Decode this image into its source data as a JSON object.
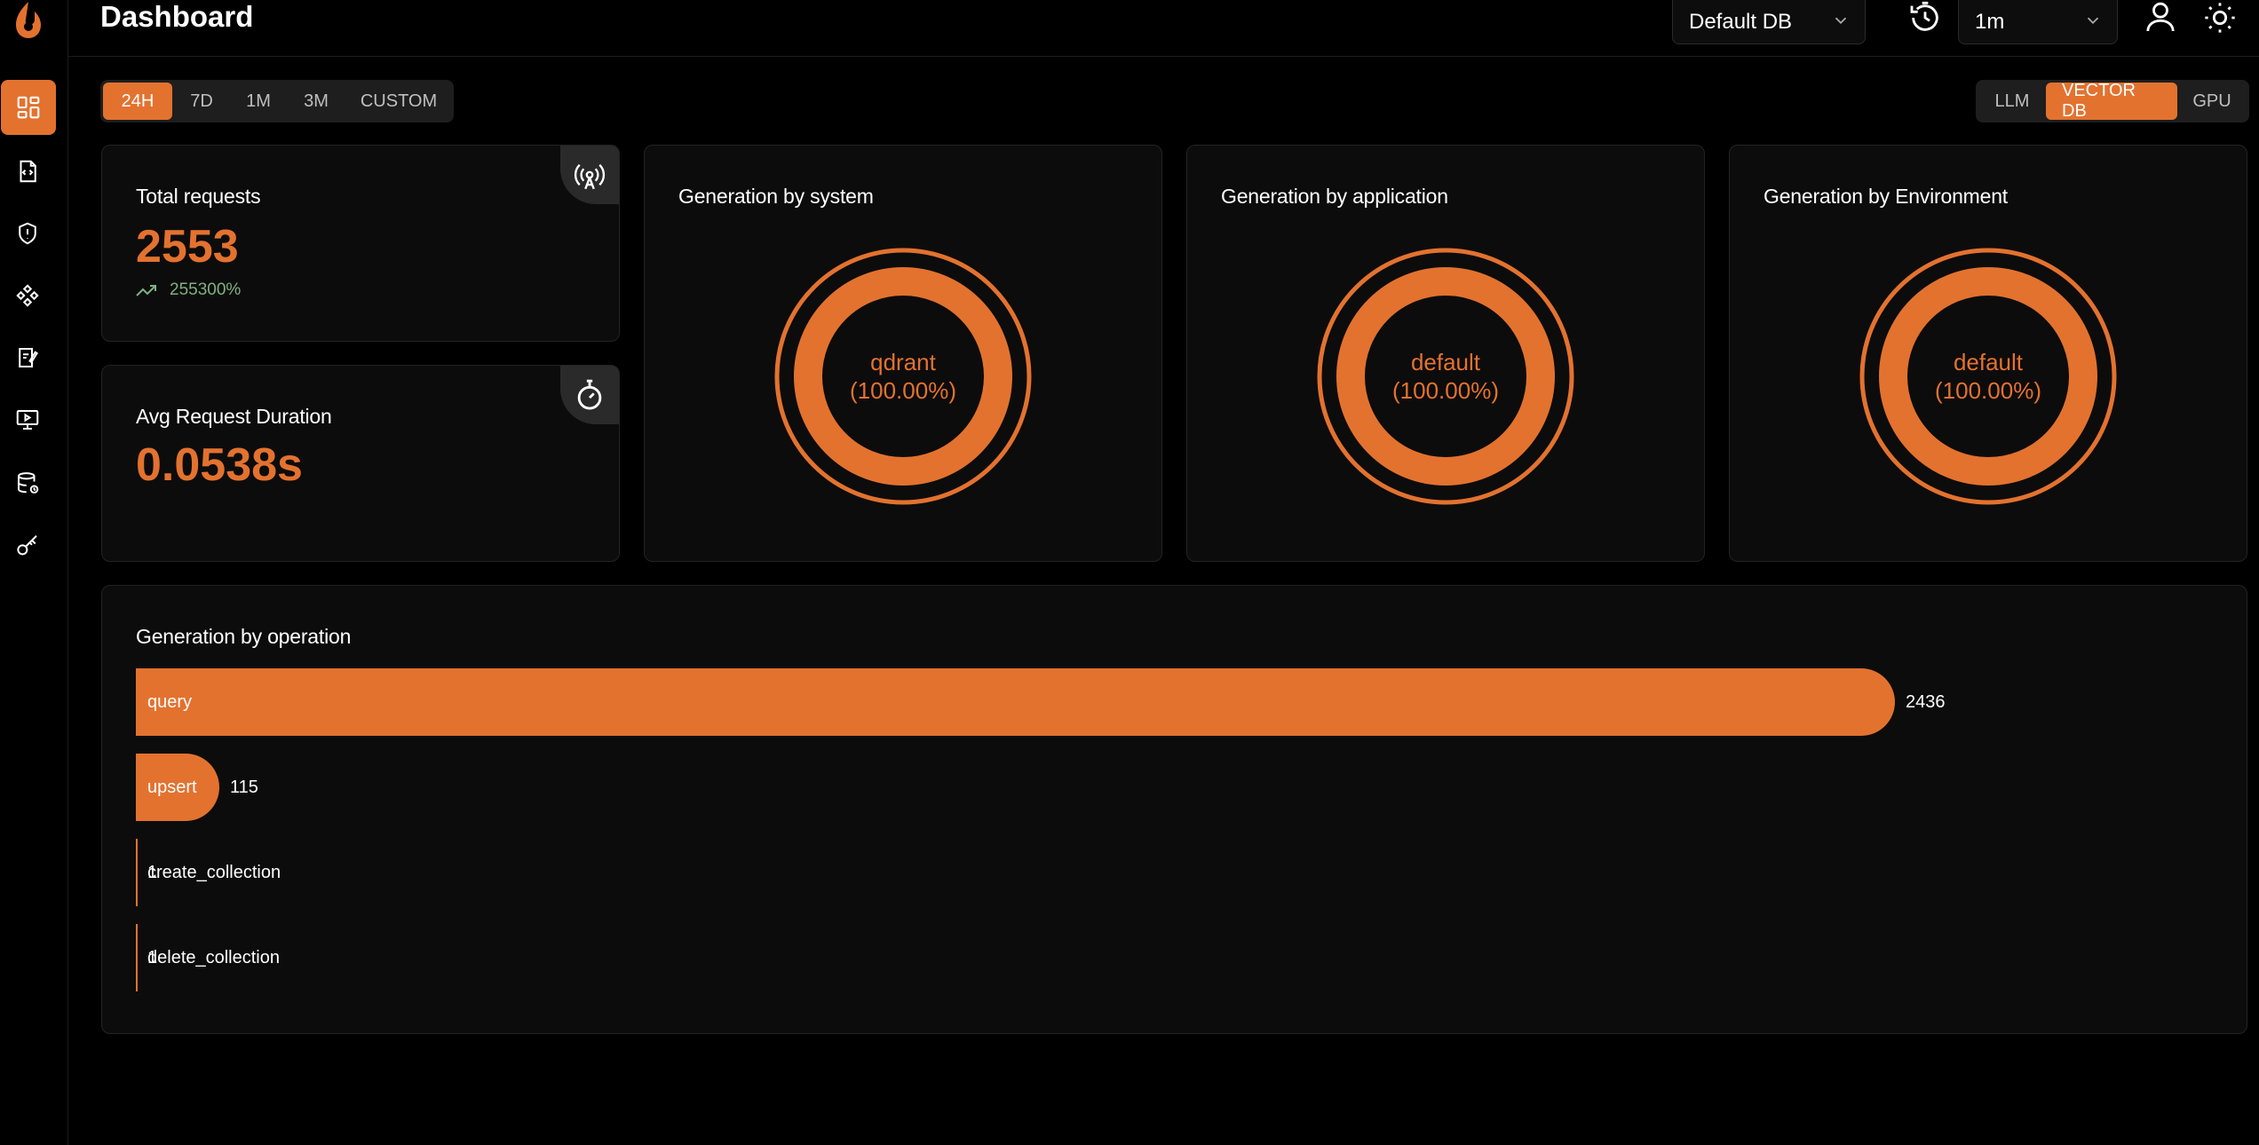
{
  "header": {
    "title": "Dashboard",
    "db_select": "Default DB",
    "refresh_select": "1m"
  },
  "sidebar": {
    "items": [
      {
        "icon": "dashboard-icon",
        "active": true
      },
      {
        "icon": "code-file-icon"
      },
      {
        "icon": "shield-icon"
      },
      {
        "icon": "components-icon"
      },
      {
        "icon": "prompt-book-icon"
      },
      {
        "icon": "monitor-play-icon"
      },
      {
        "icon": "database-icon"
      },
      {
        "icon": "key-icon"
      }
    ]
  },
  "time_filters": [
    "24H",
    "7D",
    "1M",
    "3M",
    "CUSTOM"
  ],
  "time_filter_active": "24H",
  "type_filters": [
    "LLM",
    "VECTOR DB",
    "GPU"
  ],
  "type_filter_active": "VECTOR DB",
  "stats": {
    "total_requests": {
      "title": "Total requests",
      "value": "2553",
      "trend": "255300%"
    },
    "avg_duration": {
      "title": "Avg Request Duration",
      "value": "0.0538s"
    }
  },
  "donuts": [
    {
      "title": "Generation by system",
      "label": "qdrant",
      "pct": "(100.00%)"
    },
    {
      "title": "Generation by application",
      "label": "default",
      "pct": "(100.00%)"
    },
    {
      "title": "Generation by Environment",
      "label": "default",
      "pct": "(100.00%)"
    }
  ],
  "operations": {
    "title": "Generation by operation"
  },
  "chart_data": {
    "type": "bar",
    "orientation": "horizontal",
    "title": "Generation by operation",
    "categories": [
      "query",
      "upsert",
      "create_collection",
      "delete_collection"
    ],
    "values": [
      2436,
      115,
      1,
      1
    ],
    "value_labels": [
      "2436",
      "115",
      "1",
      "1"
    ],
    "color": "#E3722F"
  },
  "colors": {
    "accent": "#E3722F",
    "trend_up": "#7fb27f",
    "card_bg": "#0d0c0c"
  }
}
